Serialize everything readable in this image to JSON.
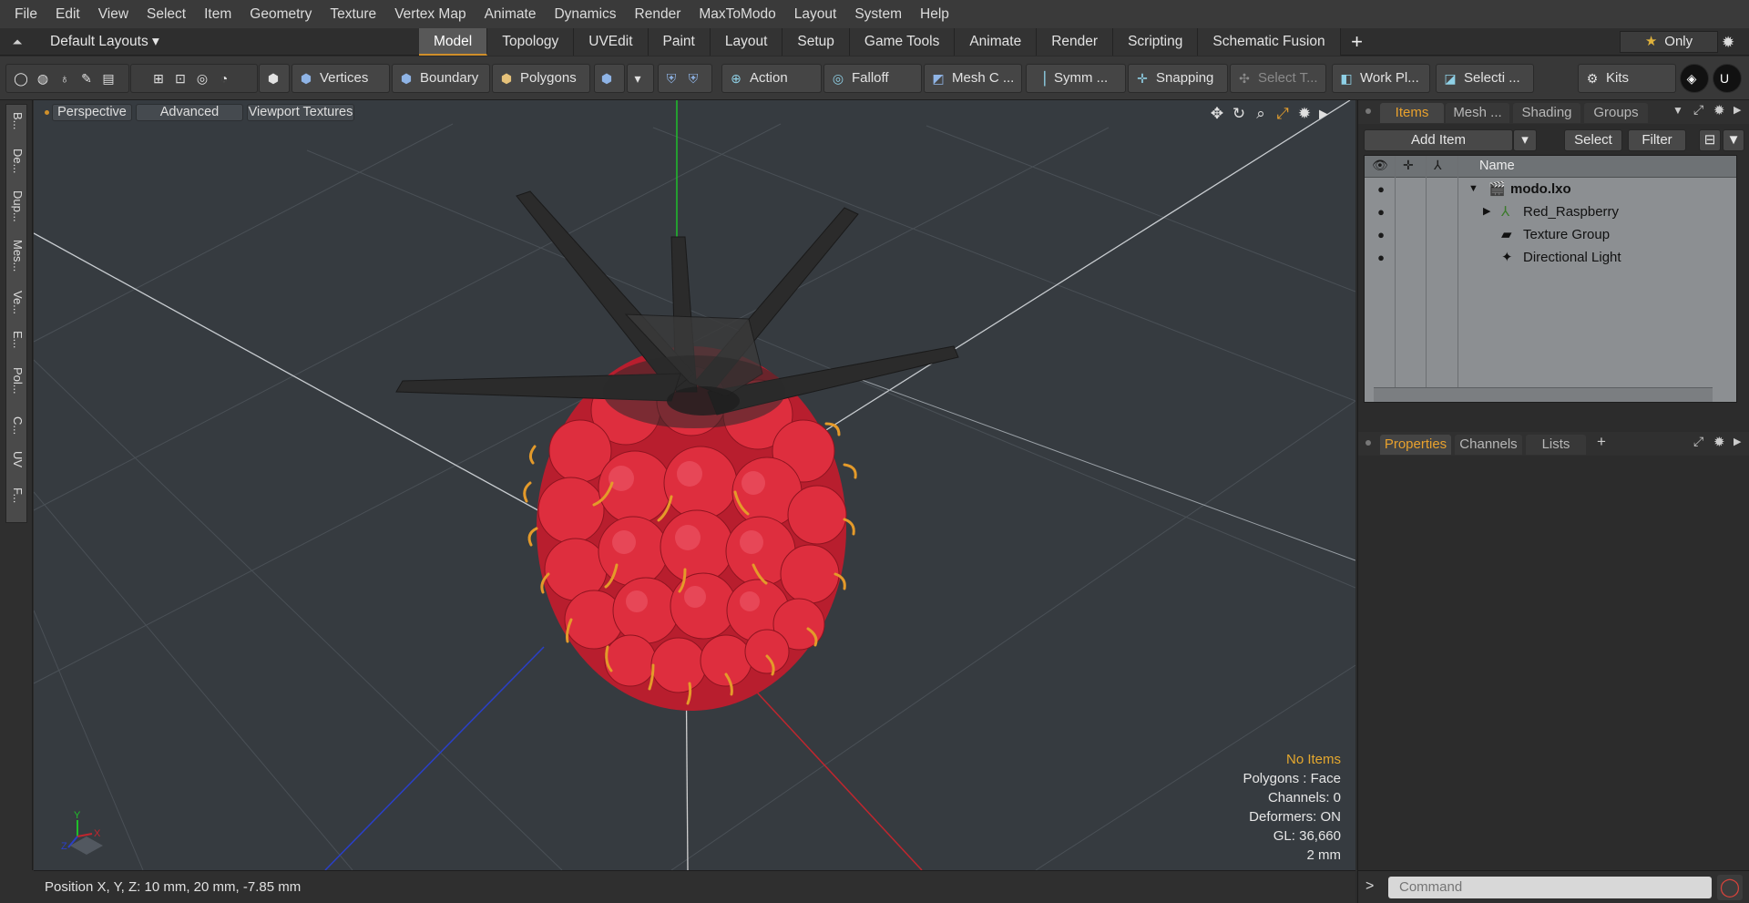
{
  "menu": [
    "File",
    "Edit",
    "View",
    "Select",
    "Item",
    "Geometry",
    "Texture",
    "Vertex Map",
    "Animate",
    "Dynamics",
    "Render",
    "MaxToModo",
    "Layout",
    "System",
    "Help"
  ],
  "layout_bar": {
    "default_layouts": "Default Layouts",
    "tabs": [
      "Model",
      "Topology",
      "UVEdit",
      "Paint",
      "Layout",
      "Setup",
      "Game Tools",
      "Animate",
      "Render",
      "Scripting",
      "Schematic Fusion"
    ],
    "active_tab": "Model",
    "plus": "+",
    "only_label": "Only"
  },
  "toolbar": {
    "vertices": "Vertices",
    "boundary": "Boundary",
    "polygons": "Polygons",
    "action": "Action",
    "falloff": "Falloff",
    "mesh_c": "Mesh C ...",
    "symm": "Symm ...",
    "snapping": "Snapping",
    "select_t": "Select T...",
    "work_pl": "Work Pl...",
    "selecti": "Selecti ...",
    "kits": "Kits"
  },
  "left_tabs": [
    "B...",
    "De...",
    "Dup...",
    "Mes...",
    "Ve...",
    "E...",
    "Pol...",
    "C...",
    "UV",
    "F..."
  ],
  "viewport": {
    "perspective": "Perspective",
    "advanced": "Advanced",
    "viewport_textures": "Viewport Textures",
    "info": {
      "no_items": "No Items",
      "polygons": "Polygons : Face",
      "channels": "Channels: 0",
      "deformers": "Deformers: ON",
      "gl": "GL: 36,660",
      "scale": "2 mm"
    },
    "axis_labels": {
      "y": "Y",
      "x": "X",
      "z": "Z"
    }
  },
  "status": {
    "position": "Position X, Y, Z:   10 mm, 20 mm, -7.85 mm"
  },
  "items_panel": {
    "tabs": [
      "Items",
      "Mesh ...",
      "Shading",
      "Groups"
    ],
    "active_tab": "Items",
    "add_item": "Add Item",
    "select": "Select",
    "filter": "Filter",
    "name_header": "Name",
    "rows": [
      {
        "label": "modo.lxo",
        "icon": "scene-icon"
      },
      {
        "label": "Red_Raspberry",
        "icon": "locator-icon"
      },
      {
        "label": "Texture Group",
        "icon": "folder-icon"
      },
      {
        "label": "Directional Light",
        "icon": "light-icon"
      }
    ]
  },
  "properties_panel": {
    "tabs": [
      "Properties",
      "Channels",
      "Lists"
    ],
    "active_tab": "Properties",
    "plus": "+"
  },
  "command": {
    "placeholder": "Command",
    "prompt": ">"
  },
  "colors": {
    "accent": "#e8a12d",
    "viewport_bg": "#363b40",
    "raspberry": "#d8283a",
    "leaf": "#2a2a2a",
    "axis_x": "#c0262e",
    "axis_y": "#1fbf2a",
    "axis_z": "#2a3fc8"
  }
}
